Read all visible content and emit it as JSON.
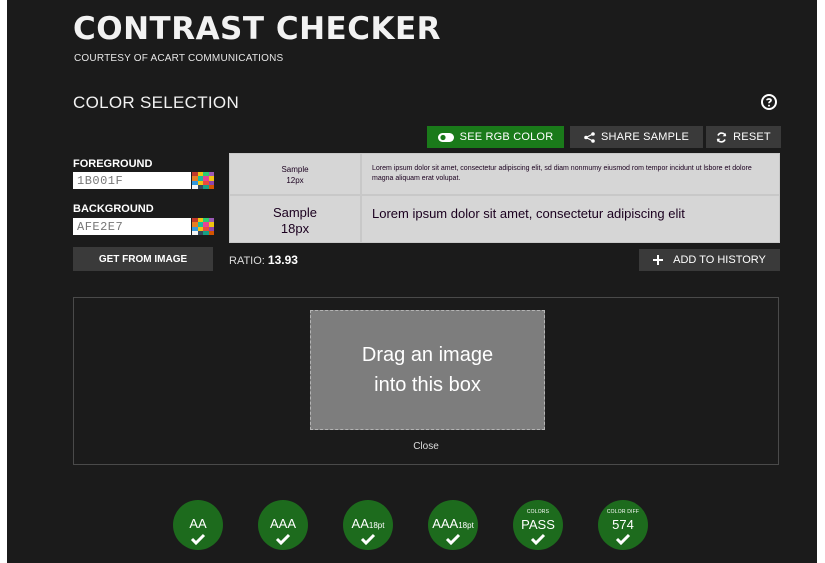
{
  "header": {
    "title": "CONTRAST CHECKER",
    "subtitle": "COURTESY OF ACART COMMUNICATIONS"
  },
  "section": {
    "title": "COLOR SELECTION",
    "help_icon": "help-circle-icon"
  },
  "toolbar": {
    "rgb_label": "SEE RGB COLOR",
    "share_label": "SHARE SAMPLE",
    "reset_label": "RESET"
  },
  "foreground": {
    "label": "FOREGROUND",
    "value": "1B001F",
    "color": "#1b001f"
  },
  "background": {
    "label": "BACKGROUND",
    "value": "AFE2E7",
    "color": "#afe2e7"
  },
  "samples": {
    "small_label_line1": "Sample",
    "small_label_line2": "12px",
    "small_text": "Lorem ipsum dolor sit amet, consectetur adipiscing elit, sd diam nonmumy eiusmod rom tempor incidunt ut lsbore et dolore magna aliquam erat volupat.",
    "large_label_line1": "Sample",
    "large_label_line2": "18px",
    "large_text": "Lorem ipsum dolor sit amet, consectetur adipiscing elit"
  },
  "actions": {
    "get_from_image": "GET FROM IMAGE",
    "ratio_label": "RATIO:",
    "ratio_value": "13.93",
    "add_history": "ADD TO HISTORY"
  },
  "dropzone": {
    "line1": "Drag an image",
    "line2": "into this box",
    "close": "Close"
  },
  "results": [
    {
      "main": "AA",
      "sub": ""
    },
    {
      "main": "AAA",
      "sub": ""
    },
    {
      "main": "AA",
      "sub": "18pt"
    },
    {
      "main": "AAA",
      "sub": "18pt"
    },
    {
      "kicker": "COLORS",
      "value": "PASS"
    },
    {
      "kicker": "COLOR DIFF",
      "value": "574"
    }
  ],
  "colors": {
    "app_bg": "#1b1b1b",
    "accent_green": "#1a7a1a",
    "badge_green": "#1d6b1d",
    "button_gray": "#3a3a3a"
  }
}
